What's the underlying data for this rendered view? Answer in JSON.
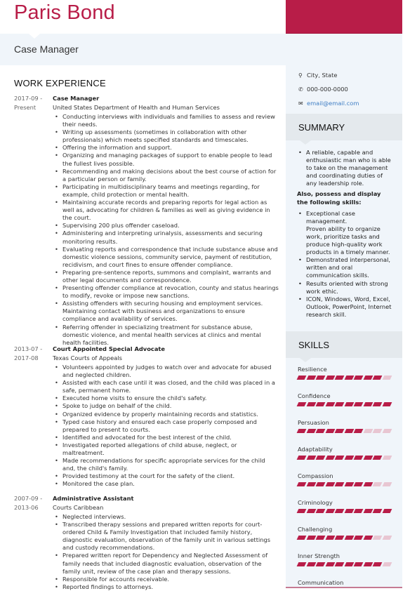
{
  "header": {
    "name": "Paris Bond",
    "job_title": "Case Manager"
  },
  "colors": {
    "accent": "#b81d48",
    "panel": "#f0f5fa",
    "section_header": "#e4e9ed",
    "link": "#3f7ec4",
    "bar_off": "#e8c6d2"
  },
  "work_experience": {
    "heading": "WORK EXPERIENCE",
    "jobs": [
      {
        "date_start": "2017-09 -",
        "date_end": "Present",
        "role": "Case Manager",
        "org": "United States Department of Health and Human Services",
        "bullets": [
          "Conducting interviews with individuals and families to assess and review their needs.",
          "Writing up assessments (sometimes in collaboration with other professionals) which meets specified standards and timescales.",
          "Offering the information and support.",
          "Organizing and managing packages of support to enable people to lead the fullest lives possible.",
          "Recommending and making decisions about the best course of action for a particular person or family.",
          "Participating in multidisciplinary teams and meetings regarding, for example, child protection or mental health.",
          "Maintaining accurate records and preparing reports for legal action as well as, advocating for children & families as well as giving evidence in the court.",
          "Supervising 200 plus offender caseload.",
          "Administering and interpreting urinalysis, assessments and securing monitoring results.",
          "Evaluating reports and correspondence that include substance abuse and domestic violence sessions, community service, payment of restitution, recidivism, and court fines to ensure offender compliance.",
          "Preparing pre-sentence reports, summons and complaint, warrants and other legal documents and correspondence.",
          "Presenting offender compliance at revocation, county and status hearings to modify, revoke or impose new sanctions.",
          "Assisting offenders with securing housing and employment services. Maintaining contact with business and organizations to ensure compliance and availability of services.",
          "Referring offender in specializing treatment for substance abuse, domestic violence, and mental health services at clinics and mental health facilities."
        ]
      },
      {
        "date_start": "2013-07 -",
        "date_end": "2017-08",
        "role": "Court Appointed Special Advocate",
        "org": "Texas Courts of Appeals",
        "bullets": [
          "Volunteers appointed by judges to watch over and advocate for abused and neglected children.",
          "Assisted with each case until it was closed, and the child was placed in a safe, permanent home.",
          "Executed home visits to ensure the child's safety.",
          "Spoke to judge on behalf of the child.",
          "Organized evidence by properly maintaining records and statistics.",
          "Typed case history and ensured each case properly composed and prepared to present to courts.",
          "Identified and advocated for the best interest of the child.",
          "Investigated reported allegations of child abuse, neglect, or maltreatment.",
          "Made recommendations for specific appropriate services for the child and, the child's family.",
          "Provided testimony at the court for the safety of the client.",
          "Monitored the case plan."
        ]
      },
      {
        "date_start": "2007-09 -",
        "date_end": "2013-06",
        "role": "Administrative Assistant",
        "org": "Courts Caribbean",
        "bullets": [
          "Neglected interviews.",
          "Transcribed therapy sessions and prepared written reports for court-ordered Child & Family Investigation that included family history, diagnostic evaluation, observation of the family unit in various settings and custody recommendations.",
          "Prepared written report for Dependency and Neglected Assessment of family needs that included diagnostic evaluation, observation of the family unit, review of the case plan and therapy sessions.",
          "Responsible for accounts receivable.",
          "Reported findings to attorneys."
        ]
      }
    ]
  },
  "contact": {
    "location": "City, State",
    "phone": "000-000-0000",
    "email": "email@email.com",
    "icons": [
      "map-pin-icon",
      "phone-icon",
      "envelope-icon"
    ]
  },
  "summary": {
    "heading": "SUMMARY",
    "intro_bullets": [
      "A reliable, capable and enthusiastic man who is able to take on the management and coordinating duties of any leadership role."
    ],
    "skills_intro": "Also, possess and display the following skills:",
    "skill_bullets": [
      "Exceptional case management.\nProven ability to organize work, prioritize tasks and produce high-quality work products in a timely manner.",
      "Demonstrated interpersonal, written and oral communication skills.",
      "Results oriented with strong work ethic.",
      "ICON, Windows, Word, Excel, Outlook, PowerPoint, Internet research skill."
    ]
  },
  "skills": {
    "heading": "SKILLS",
    "scale_max": 10,
    "items": [
      {
        "name": "Resilience",
        "level": 9
      },
      {
        "name": "Confidence",
        "level": 10
      },
      {
        "name": "Persuasion",
        "level": 7
      },
      {
        "name": "Adaptability",
        "level": 9
      },
      {
        "name": "Compassion",
        "level": 8
      },
      {
        "name": "Criminology",
        "level": 10
      },
      {
        "name": "Challenging",
        "level": 8
      },
      {
        "name": "Inner Strength",
        "level": 9
      },
      {
        "name": "Communication",
        "level": null
      }
    ]
  }
}
